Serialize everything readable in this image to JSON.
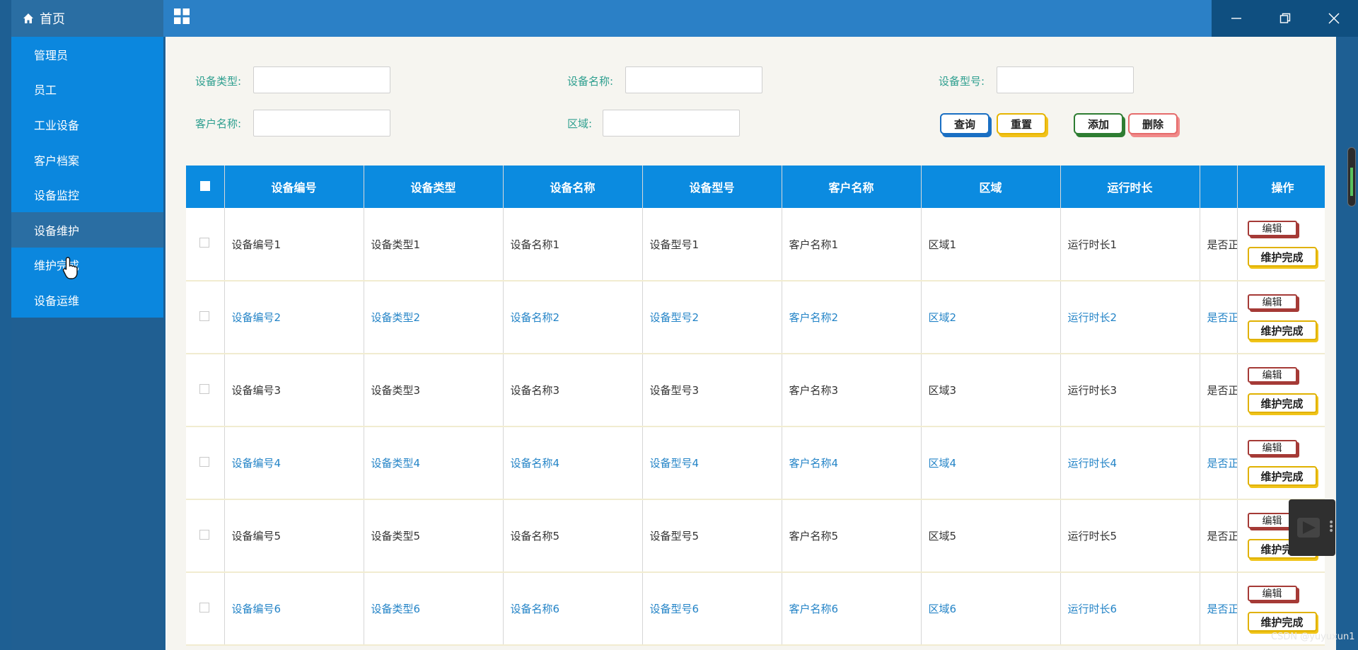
{
  "sidebar": {
    "home_label": "首页",
    "items": [
      {
        "label": "管理员"
      },
      {
        "label": "员工"
      },
      {
        "label": "工业设备"
      },
      {
        "label": "客户档案"
      },
      {
        "label": "设备监控"
      },
      {
        "label": "设备维护"
      },
      {
        "label": "维护完成"
      },
      {
        "label": "设备运维"
      }
    ],
    "active_index": 5
  },
  "topbar": {
    "menu_icon": "grid-icon",
    "minimize_icon": "minimize-icon",
    "restore_icon": "restore-icon",
    "close_icon": "close-icon"
  },
  "filters": {
    "device_type_label": "设备类型:",
    "device_name_label": "设备名称:",
    "device_model_label": "设备型号:",
    "customer_name_label": "客户名称:",
    "region_label": "区域:",
    "device_type_value": "",
    "device_name_value": "",
    "device_model_value": "",
    "customer_name_value": "",
    "region_value": ""
  },
  "actions": {
    "query": "查询",
    "reset": "重置",
    "add": "添加",
    "delete": "删除"
  },
  "table": {
    "headers": [
      "设备编号",
      "设备类型",
      "设备名称",
      "设备型号",
      "客户名称",
      "区域",
      "运行时长",
      "",
      "操作"
    ],
    "rows": [
      [
        "设备编号1",
        "设备类型1",
        "设备名称1",
        "设备型号1",
        "客户名称1",
        "区域1",
        "运行时长1",
        "是否正"
      ],
      [
        "设备编号2",
        "设备类型2",
        "设备名称2",
        "设备型号2",
        "客户名称2",
        "区域2",
        "运行时长2",
        "是否正"
      ],
      [
        "设备编号3",
        "设备类型3",
        "设备名称3",
        "设备型号3",
        "客户名称3",
        "区域3",
        "运行时长3",
        "是否正"
      ],
      [
        "设备编号4",
        "设备类型4",
        "设备名称4",
        "设备型号4",
        "客户名称4",
        "区域4",
        "运行时长4",
        "是否正"
      ],
      [
        "设备编号5",
        "设备类型5",
        "设备名称5",
        "设备型号5",
        "客户名称5",
        "区域5",
        "运行时长5",
        "是否正"
      ],
      [
        "设备编号6",
        "设备类型6",
        "设备名称6",
        "设备型号6",
        "客户名称6",
        "区域6",
        "运行时长6",
        "是否正"
      ]
    ],
    "edit_label": "编辑",
    "done_label": "维护完成"
  },
  "watermark": "CSDN @yuyuxun1",
  "colors": {
    "accent": "#0b8be0",
    "sidebar": "#205f92",
    "menu": "#0b87de",
    "topbar": "#2b80c6",
    "label_teal": "#2e9f8f",
    "alt_row_text": "#2484c7"
  }
}
